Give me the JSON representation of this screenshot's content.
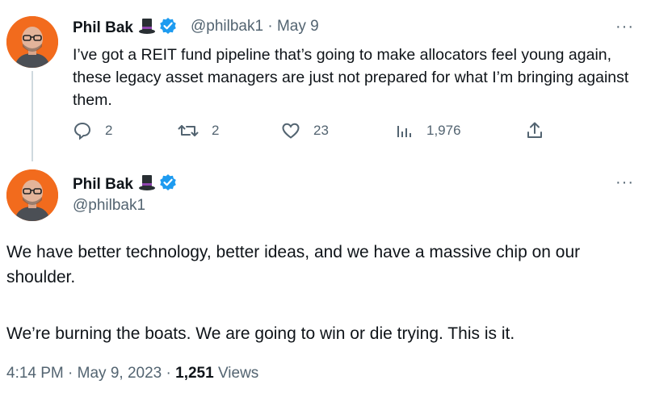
{
  "tweet1": {
    "display_name": "Phil Bak",
    "handle": "@philbak1",
    "separator": "·",
    "date": "May 9",
    "text": "I’ve got a REIT fund pipeline that’s going to make allocators feel young again, these legacy asset managers are just not prepared for what I’m bringing against them.",
    "more_label": "···",
    "stats": {
      "replies": "2",
      "retweets": "2",
      "likes": "23",
      "views": "1,976"
    }
  },
  "tweet2": {
    "display_name": "Phil Bak",
    "handle": "@philbak1",
    "more_label": "···",
    "paragraph1": "We have better technology, better ideas, and we have a massive chip on our shoulder.",
    "paragraph2": "We’re burning the boats. We are going to win or die trying. This is it.",
    "footer": {
      "time": "4:14 PM",
      "sep1": "·",
      "date": "May 9, 2023",
      "sep2": "·",
      "views_count": "1,251",
      "views_label": "Views"
    }
  },
  "icons": {
    "hat": "top-hat-emoji",
    "verified": "verified-badge-icon",
    "reply": "reply-icon",
    "retweet": "retweet-icon",
    "like": "heart-icon",
    "views": "bar-chart-icon",
    "share": "share-icon"
  },
  "colors": {
    "verified_blue": "#1d9bf0",
    "avatar_orange": "#f26b1d",
    "text_primary": "#0f1419",
    "text_secondary": "#536471",
    "thread_line": "#cfd9de"
  }
}
